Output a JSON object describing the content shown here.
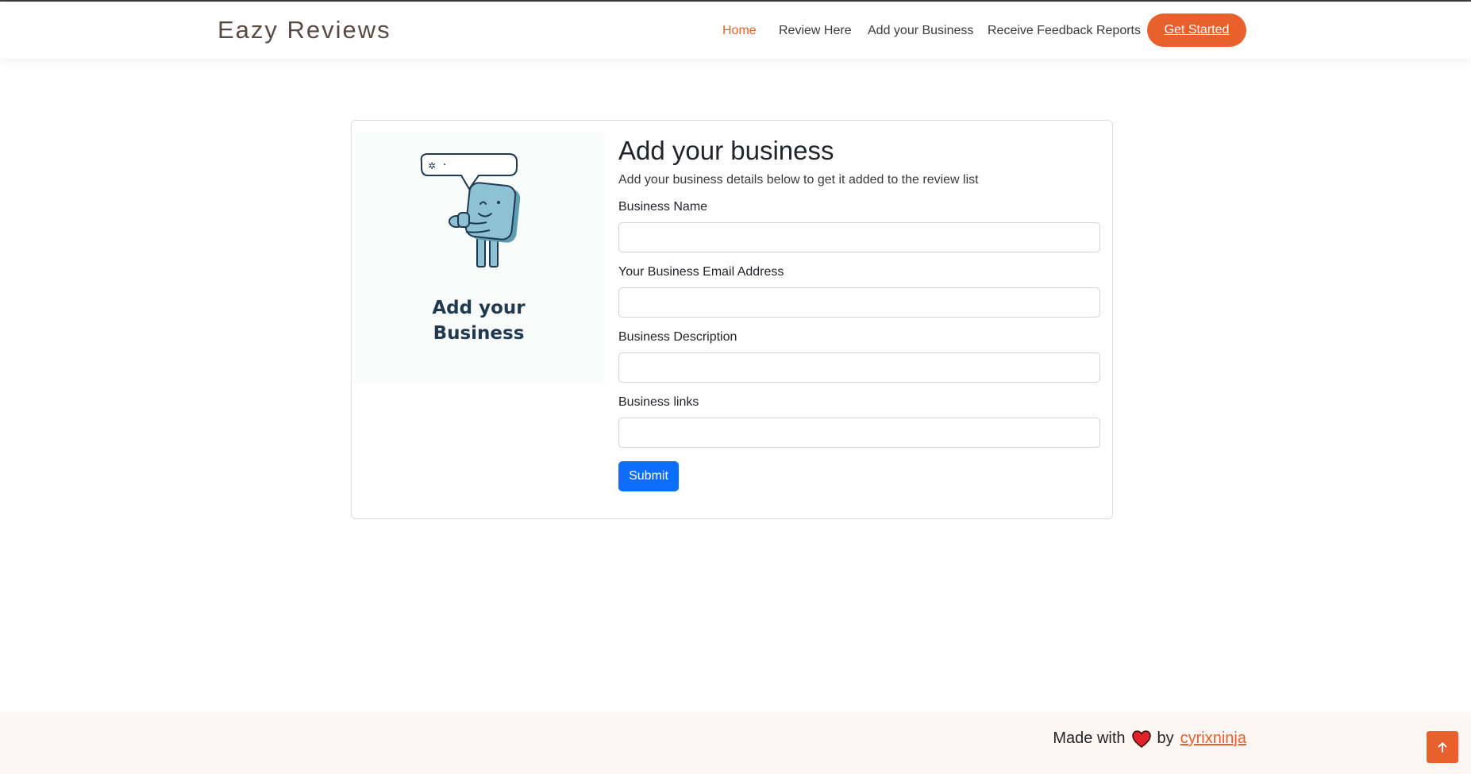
{
  "header": {
    "brand": "Eazy Reviews",
    "nav": [
      {
        "label": "Home",
        "active": true
      },
      {
        "label": "Review Here"
      },
      {
        "label": "Add your Business"
      },
      {
        "label": "Receive Feedback Reports"
      }
    ],
    "cta_label": "Get Started"
  },
  "illustration": {
    "line1": "Add your",
    "line2": "Business"
  },
  "form": {
    "title": "Add your business",
    "subtitle": "Add your business details below to get it added to the review list",
    "fields": [
      {
        "label": "Business Name",
        "value": ""
      },
      {
        "label": "Your Business Email Address",
        "value": ""
      },
      {
        "label": "Business Description",
        "value": ""
      },
      {
        "label": "Business links",
        "value": ""
      }
    ],
    "submit_label": "Submit"
  },
  "footer": {
    "made_with": "Made with",
    "by": "by",
    "author": "cyrixninja"
  },
  "colors": {
    "accent": "#e8602c",
    "primary": "#0d6efd",
    "footer_bg": "#fdf6f2"
  },
  "icons": {
    "heart": "heart-icon",
    "back_to_top": "arrow-up-icon"
  }
}
